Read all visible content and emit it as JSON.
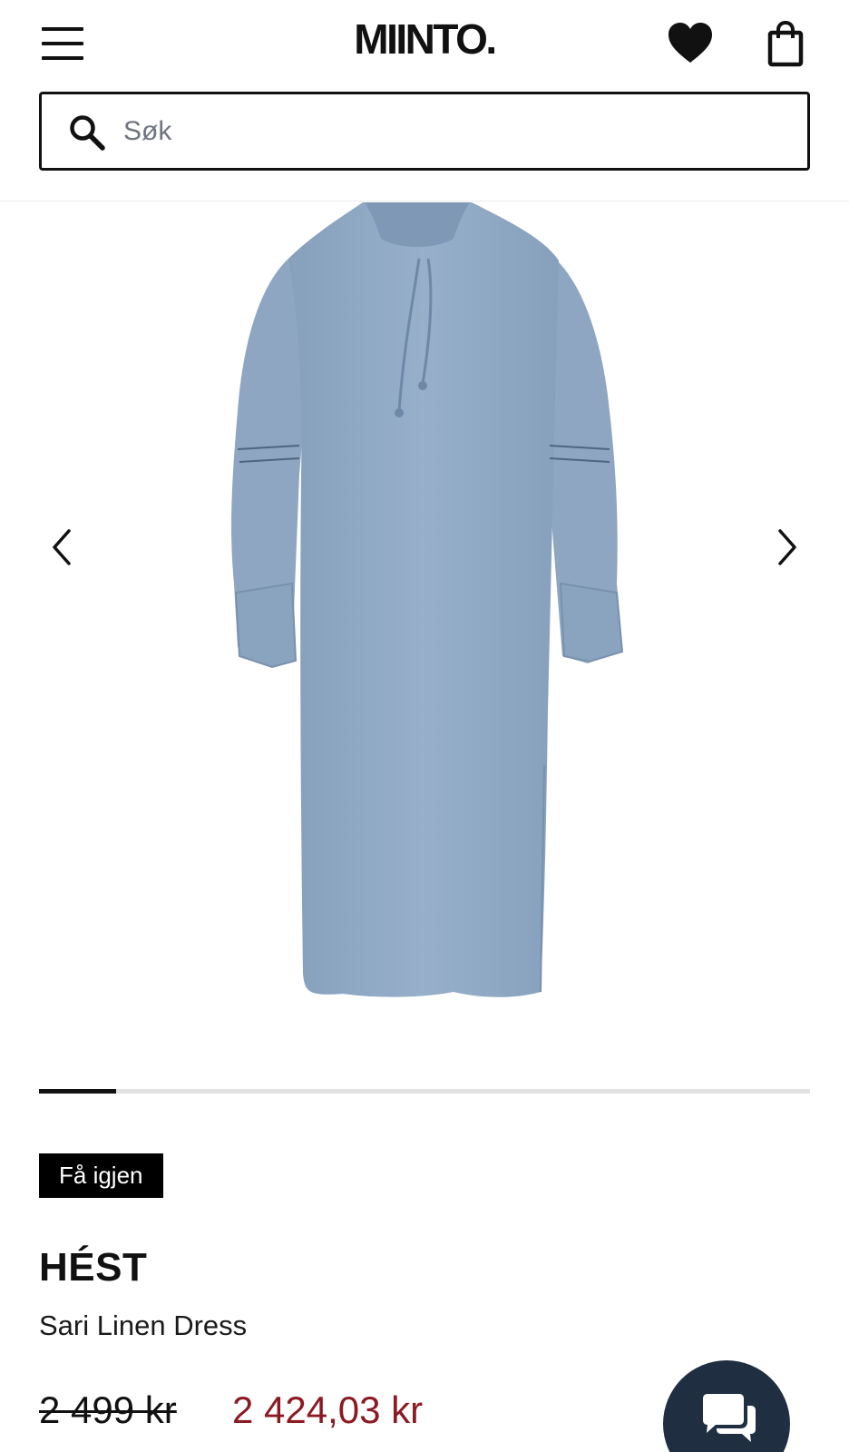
{
  "header": {
    "logo": "MIINTO.",
    "menu_icon": "hamburger-menu-icon",
    "favorites_icon": "heart-icon",
    "bag_icon": "shopping-bag-icon"
  },
  "search": {
    "placeholder": "Søk",
    "value": "",
    "icon": "search-icon"
  },
  "gallery": {
    "image_alt": "Sari Linen Dress",
    "image_color": "#93aac5",
    "prev_icon": "chevron-left-icon",
    "next_icon": "chevron-right-icon",
    "current_image_index": 1,
    "progress_fraction": 0.1
  },
  "product": {
    "badge": "Få igjen",
    "brand": "HÉST",
    "name": "Sari Linen Dress",
    "original_price": "2 499 kr",
    "sale_price": "2 424,03 kr",
    "sale_color": "#8b1a22"
  },
  "chat": {
    "icon": "chat-bubbles-icon",
    "color": "#1f2e40"
  }
}
